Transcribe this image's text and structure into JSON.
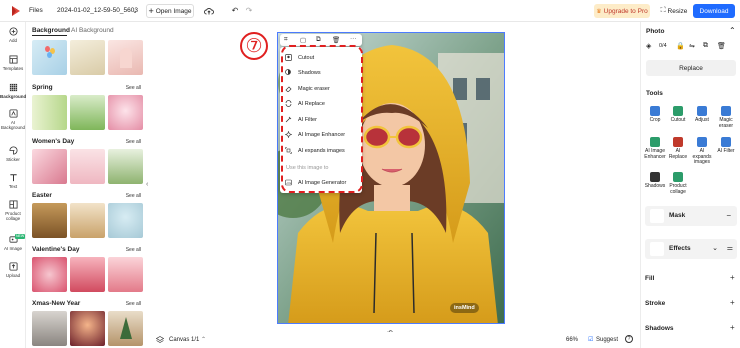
{
  "topbar": {
    "files": "Files",
    "filename": "2024-01-02_12-59-50_5603",
    "open_image": "Open Image",
    "upgrade": "Upgrade to Pro",
    "resize": "Resize",
    "download": "Download"
  },
  "leftnav": [
    {
      "label": "Add",
      "icon": "plus-circle-icon"
    },
    {
      "label": "Templates",
      "icon": "templates-icon"
    },
    {
      "label": "Background",
      "icon": "background-icon"
    },
    {
      "label": "AI Background",
      "icon": "ai-background-icon"
    },
    {
      "label": "Sticker",
      "icon": "sticker-icon"
    },
    {
      "label": "Text",
      "icon": "text-icon"
    },
    {
      "label": "Product collage",
      "icon": "product-collage-icon"
    },
    {
      "label": "AI Image",
      "icon": "ai-image-icon",
      "badge": "NEW"
    },
    {
      "label": "Upload",
      "icon": "upload-icon"
    }
  ],
  "leftpanel": {
    "tabs": [
      "Background",
      "AI Background"
    ],
    "sections": [
      {
        "title": "Spring",
        "see_all": "See all"
      },
      {
        "title": "Women's Day",
        "see_all": "See all"
      },
      {
        "title": "Easter",
        "see_all": "See all"
      },
      {
        "title": "Valentine's Day",
        "see_all": "See all"
      },
      {
        "title": "Xmas-New Year",
        "see_all": "See all"
      }
    ]
  },
  "step_marker": "⑦",
  "context_toolbar": [
    "crop-icon",
    "copy-icon",
    "duplicate-icon",
    "delete-icon",
    "more-icon"
  ],
  "context_menu": {
    "items": [
      "Cutout",
      "Shadows",
      "Magic eraser",
      "AI Replace",
      "AI Filter",
      "AI Image Enhancer",
      "AI expands images"
    ],
    "section_label": "Use this image to",
    "generator": "AI Image Generator"
  },
  "watermark": "insMind",
  "bottombar": {
    "canvas": "Canvas 1/1",
    "zoom": "66%",
    "suggest": "Suggest",
    "help": "?"
  },
  "rightpanel": {
    "photo_title": "Photo",
    "replace": "Replace",
    "tools_title": "Tools",
    "tools": [
      {
        "label": "Crop",
        "color": "#3a7bd5"
      },
      {
        "label": "Cutout",
        "color": "#2c9c6a"
      },
      {
        "label": "Adjust",
        "color": "#3a7bd5"
      },
      {
        "label": "Magic eraser",
        "color": "#3a7bd5"
      },
      {
        "label": "AI Image Enhancer",
        "color": "#2c9c6a"
      },
      {
        "label": "AI Replace",
        "color": "#c0392b"
      },
      {
        "label": "AI expands images",
        "color": "#3a7bd5"
      },
      {
        "label": "AI Filter",
        "color": "#3a7bd5"
      },
      {
        "label": "Shadows",
        "color": "#333333"
      },
      {
        "label": "Product collage",
        "color": "#2c9c6a"
      }
    ],
    "mask": "Mask",
    "effects": "Effects",
    "fill": "Fill",
    "stroke": "Stroke",
    "shadows": "Shadows"
  },
  "colors": {
    "accent": "#1f6bff",
    "upgrade_bg": "#fdecc8",
    "upgrade_text": "#c0392b",
    "annotation_red": "#e02020"
  }
}
